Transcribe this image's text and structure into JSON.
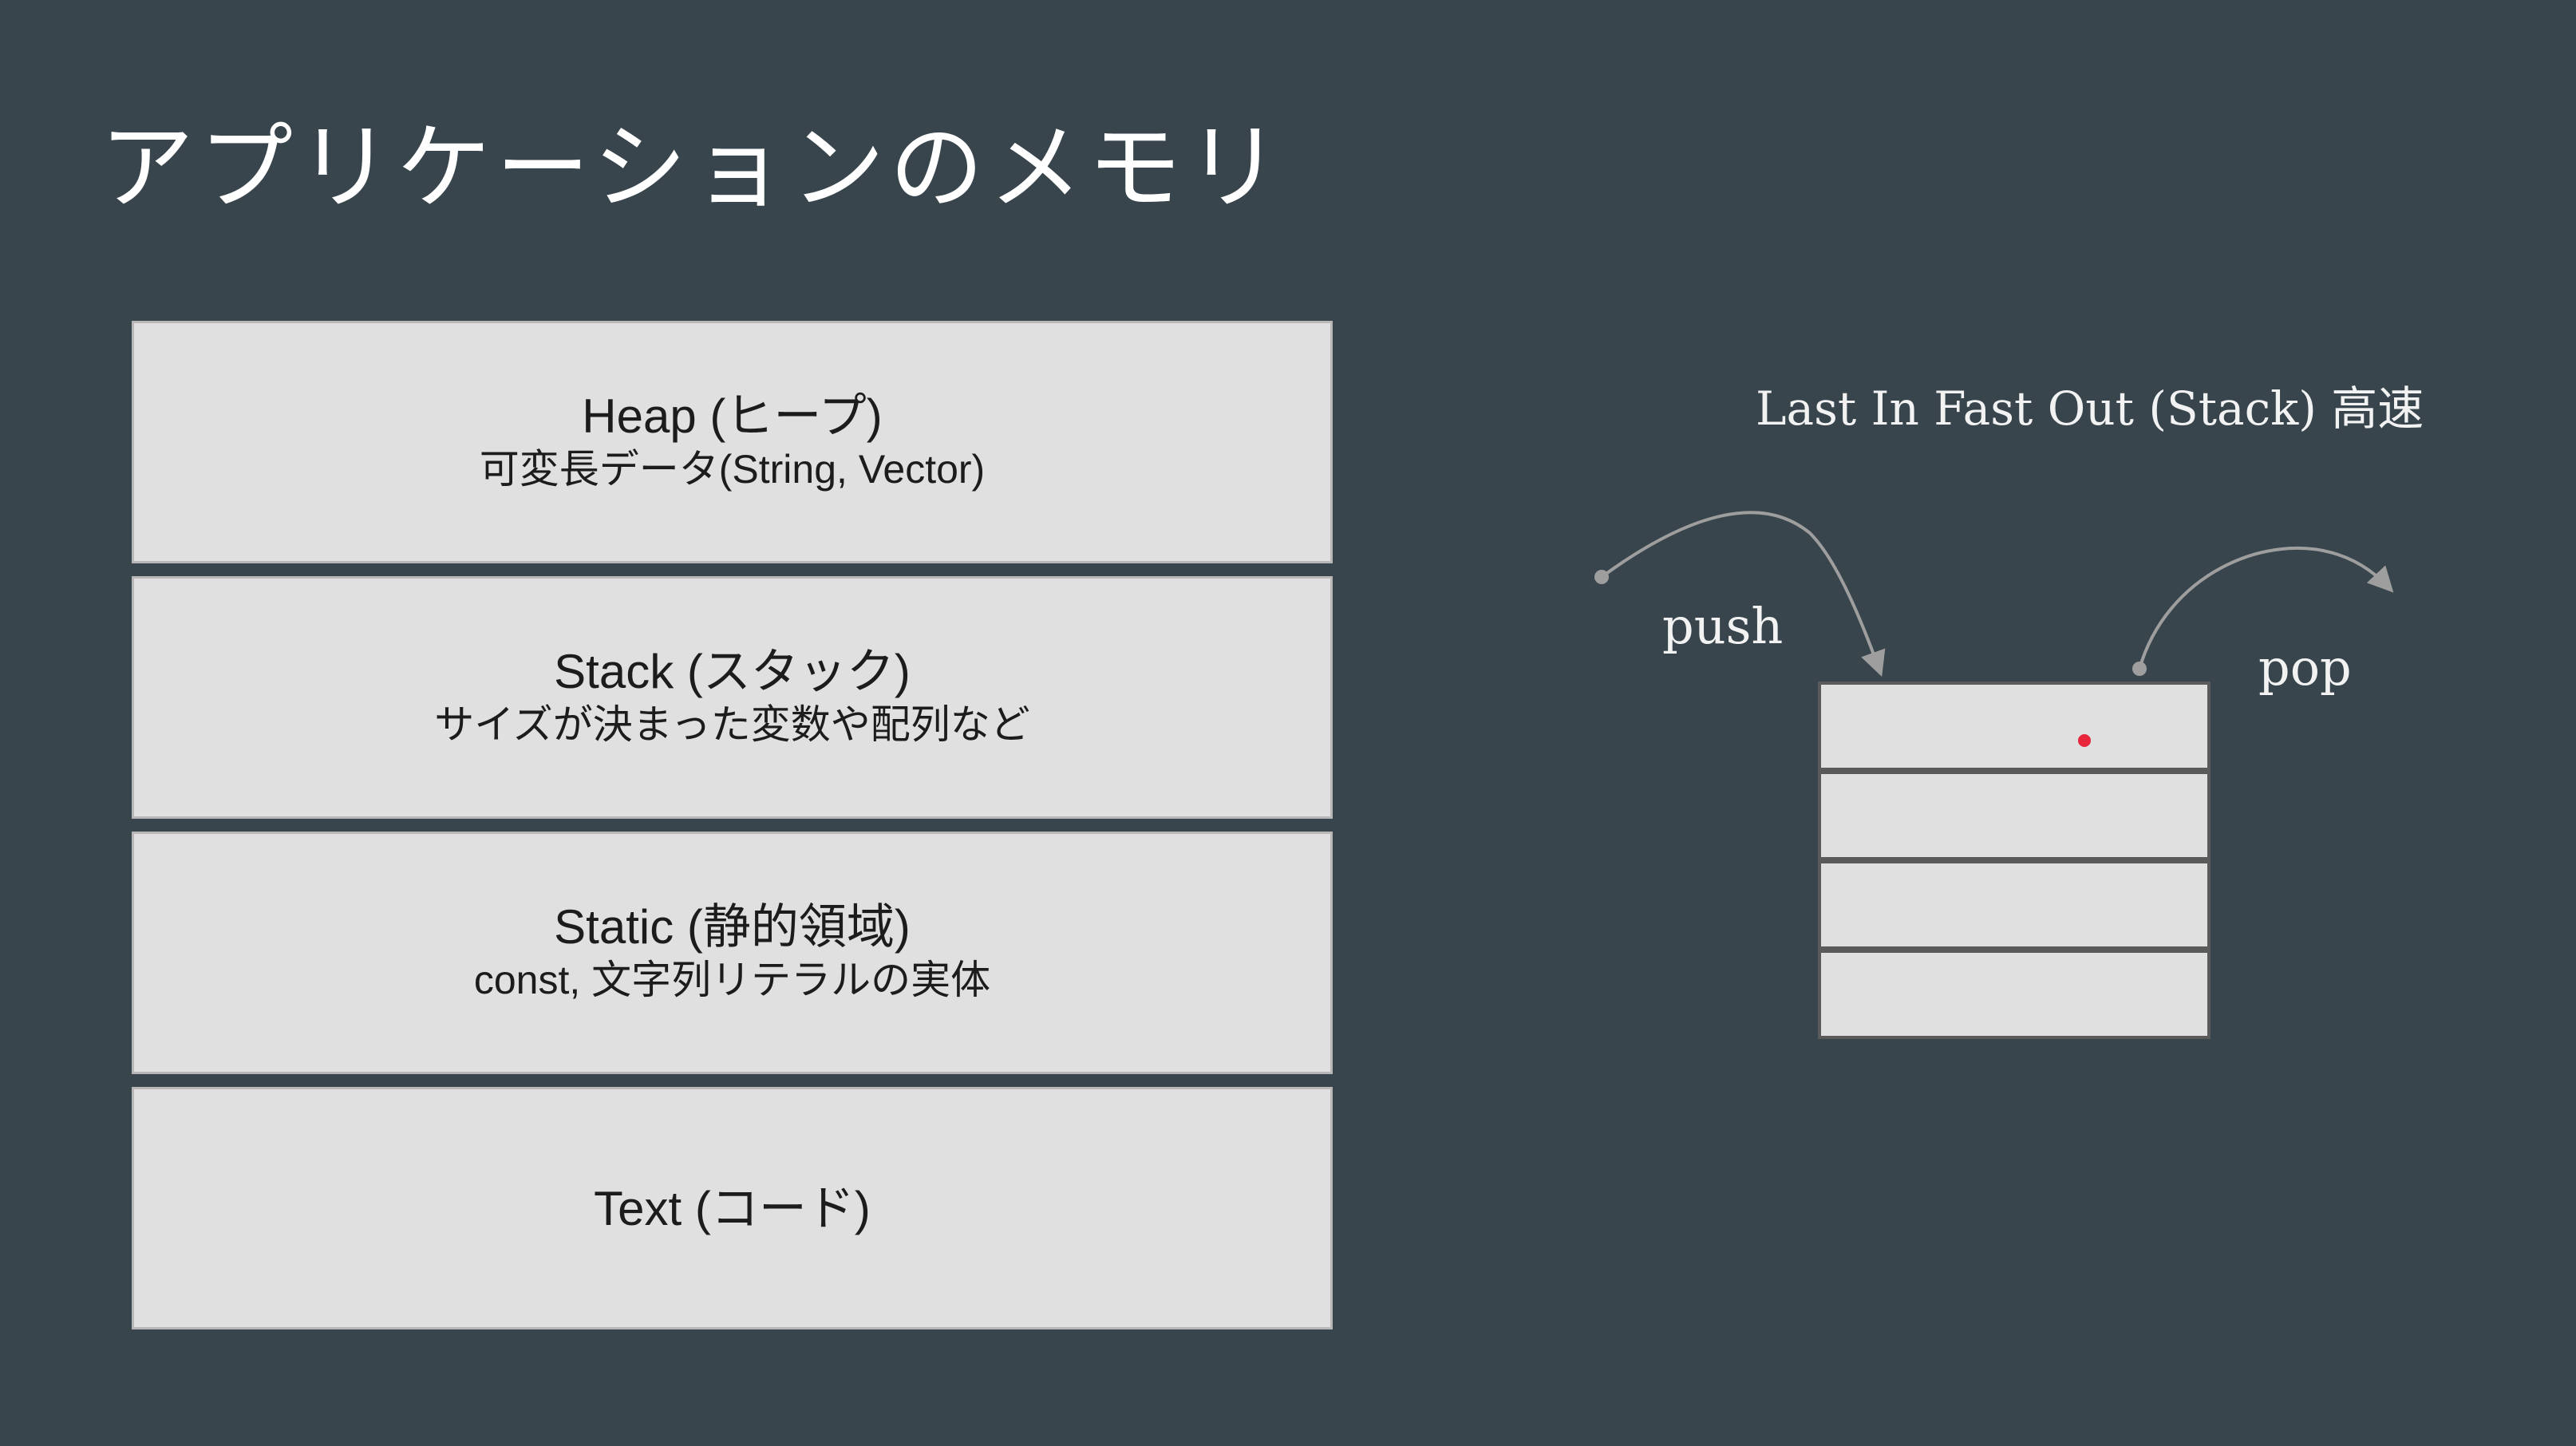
{
  "title": "アプリケーションのメモリ",
  "memory_layout": [
    {
      "title": "Heap (ヒープ)",
      "subtitle": "可変長データ(String, Vector)"
    },
    {
      "title": "Stack (スタック)",
      "subtitle": "サイズが決まった変数や配列など"
    },
    {
      "title": "Static (静的領域)",
      "subtitle": "const, 文字列リテラルの実体"
    },
    {
      "title": "Text (コード)",
      "subtitle": ""
    }
  ],
  "stack_diagram": {
    "caption": "Last In Fast Out (Stack) 高速",
    "push_label": "push",
    "pop_label": "pop",
    "cell_count": 4
  },
  "colors": {
    "background": "#38454d",
    "block_fill": "#e0e0e0",
    "arrow": "#9e9e9e",
    "marker": "#e8253a"
  }
}
